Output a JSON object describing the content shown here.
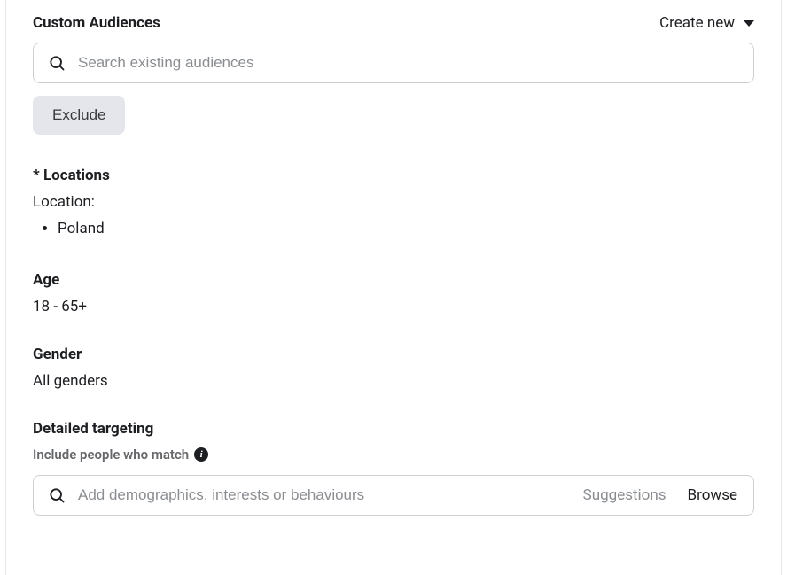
{
  "customAudiences": {
    "heading": "Custom Audiences",
    "createNew": "Create new",
    "searchPlaceholder": "Search existing audiences",
    "excludeLabel": "Exclude"
  },
  "locations": {
    "heading": "* Locations",
    "label": "Location:",
    "items": [
      "Poland"
    ]
  },
  "age": {
    "heading": "Age",
    "value": "18 - 65+"
  },
  "gender": {
    "heading": "Gender",
    "value": "All genders"
  },
  "detailed": {
    "heading": "Detailed targeting",
    "includeLabel": "Include people who match",
    "searchPlaceholder": "Add demographics, interests or behaviours",
    "suggestions": "Suggestions",
    "browse": "Browse"
  }
}
